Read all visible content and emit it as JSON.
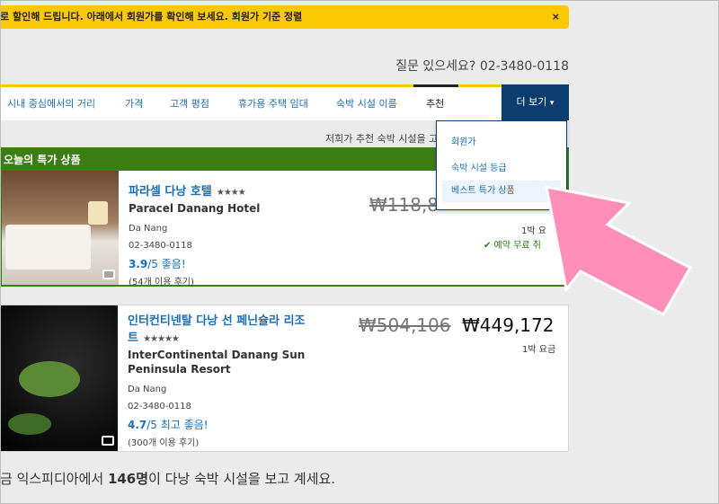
{
  "banner": {
    "text": "로 할인해 드립니다. 아래에서 회원가를 확인해 보세요. 회원가 기준 정렬",
    "close": "×"
  },
  "help": {
    "text": "질문 있으세요? 02-3480-0118"
  },
  "sort_tabs": [
    "시내 중심에서의 거리",
    "가격",
    "고객 평점",
    "휴가용 주택 임대",
    "숙박 시설 이름",
    "추천"
  ],
  "more_button": "더 보기",
  "subnote": "저희가 추천 숙박 시설을 고",
  "dropdown": {
    "items": [
      "회원가",
      "숙박 시설 등급",
      "베스트 특가 상품"
    ]
  },
  "deal_header": "오늘의 특가 상품",
  "hotels": [
    {
      "name_ko": "파라셀 다낭 호텔",
      "stars": "★★★★",
      "name_en": "Paracel Danang Hotel",
      "location": "Da Nang",
      "phone": "02-3480-0118",
      "rating": "3.9",
      "rating_suffix": "/5 좋음!",
      "reviews": "(54개 이용 후기)",
      "old_price": "₩118,8",
      "per_night": "1박 요",
      "free_cancel": "✔ 예약 무료 취"
    },
    {
      "name_ko_line1": "인터컨티넨탈 다낭 선 페닌슐라 리조",
      "name_ko_line2": "트",
      "stars": "★★★★★",
      "name_en_line1": "InterContinental Danang Sun",
      "name_en_line2": "Peninsula Resort",
      "location": "Da Nang",
      "phone": "02-3480-0118",
      "rating": "4.7",
      "rating_suffix": "/5 최고 좋음!",
      "reviews": "(300개 이용 후기)",
      "old_price": "₩504,106",
      "new_price": "₩449,172",
      "per_night": "1박 요금"
    }
  ],
  "footer": {
    "prefix": "금 익스피디아에서 ",
    "count": "146명",
    "suffix": "이 다낭 숙박 시설을 보고 계세요."
  },
  "colors": {
    "banner_bg": "#fbc804",
    "deal_green": "#3c7d15",
    "nav_blue": "#0b3e6f",
    "link_blue": "#1a6eb5",
    "arrow_pink": "#ff8fb8"
  }
}
